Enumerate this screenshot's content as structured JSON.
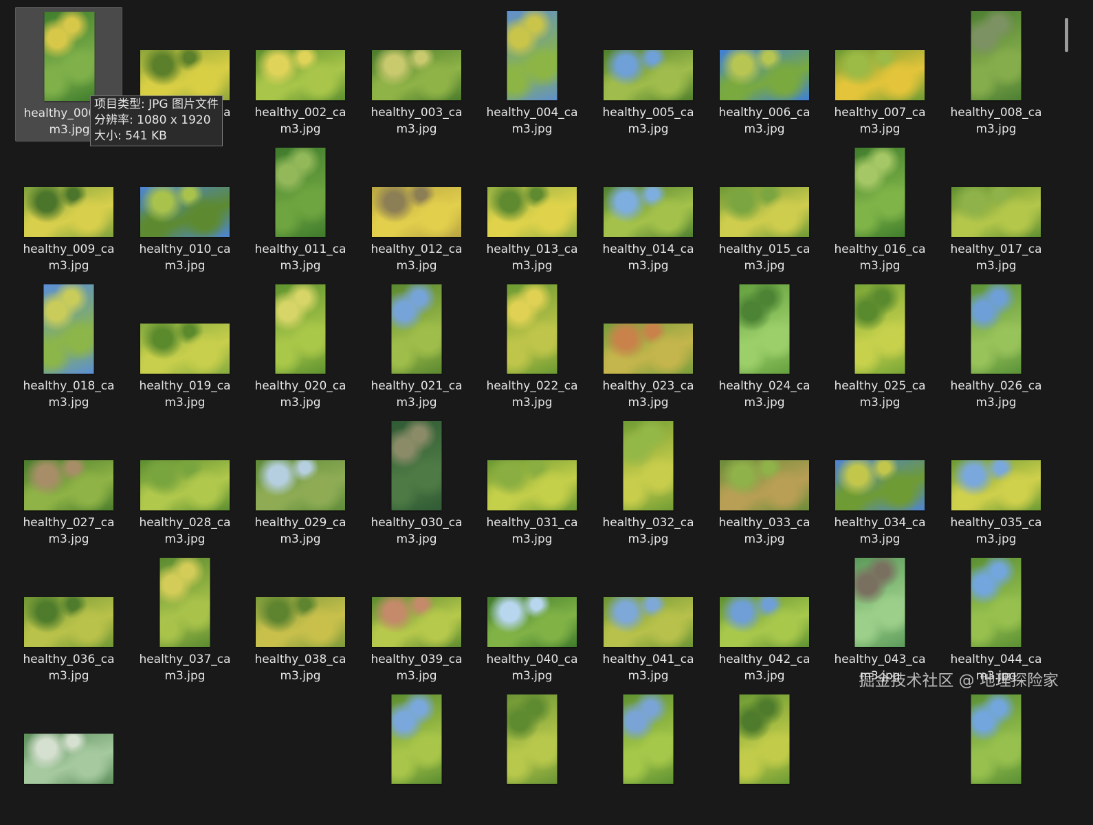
{
  "files": [
    {
      "line1": "healthy_000_ca",
      "line2": "m3.jpg",
      "orientation": "portrait",
      "colors": [
        "#3f7d2d",
        "#7fb04a",
        "#d8c84a"
      ]
    },
    {
      "line1": "healthy_001_ca",
      "line2": "m3.jpg",
      "orientation": "landscape",
      "colors": [
        "#8ea63a",
        "#d9cf45",
        "#5b7f2a"
      ]
    },
    {
      "line1": "healthy_002_ca",
      "line2": "m3.jpg",
      "orientation": "landscape",
      "colors": [
        "#5d8f2f",
        "#a9c64a",
        "#e0d35a"
      ]
    },
    {
      "line1": "healthy_003_ca",
      "line2": "m3.jpg",
      "orientation": "landscape",
      "colors": [
        "#4a7a2c",
        "#8fb347",
        "#c9c96e"
      ]
    },
    {
      "line1": "healthy_004_ca",
      "line2": "m3.jpg",
      "orientation": "portrait",
      "colors": [
        "#5f8fcf",
        "#8cb546",
        "#c9c44a"
      ]
    },
    {
      "line1": "healthy_005_ca",
      "line2": "m3.jpg",
      "orientation": "landscape",
      "colors": [
        "#4f7f2c",
        "#9fbc4c",
        "#6fa0d8"
      ]
    },
    {
      "line1": "healthy_006_ca",
      "line2": "m3.jpg",
      "orientation": "landscape",
      "colors": [
        "#3f7fd8",
        "#79a93f",
        "#b7c552"
      ]
    },
    {
      "line1": "healthy_007_ca",
      "line2": "m3.jpg",
      "orientation": "landscape",
      "colors": [
        "#6b9a34",
        "#e3c43a",
        "#9bba46"
      ]
    },
    {
      "line1": "healthy_008_ca",
      "line2": "m3.jpg",
      "orientation": "portrait",
      "colors": [
        "#4c7e32",
        "#86ad4c",
        "#7d9263"
      ]
    },
    {
      "line1": "healthy_009_ca",
      "line2": "m3.jpg",
      "orientation": "landscape",
      "colors": [
        "#7da23d",
        "#d8cf4c",
        "#4b752a"
      ]
    },
    {
      "line1": "healthy_010_ca",
      "line2": "m3.jpg",
      "orientation": "landscape",
      "colors": [
        "#4d86d6",
        "#5d8a30",
        "#a8c24c"
      ]
    },
    {
      "line1": "healthy_011_ca",
      "line2": "m3.jpg",
      "orientation": "portrait",
      "colors": [
        "#3e7a2c",
        "#6ea540",
        "#93b85a"
      ]
    },
    {
      "line1": "healthy_012_ca",
      "line2": "m3.jpg",
      "orientation": "landscape",
      "colors": [
        "#b8a543",
        "#e2cf4c",
        "#8d7f55"
      ]
    },
    {
      "line1": "healthy_013_ca",
      "line2": "m3.jpg",
      "orientation": "landscape",
      "colors": [
        "#94b042",
        "#e0d34b",
        "#5f8a30"
      ]
    },
    {
      "line1": "healthy_014_ca",
      "line2": "m3.jpg",
      "orientation": "landscape",
      "colors": [
        "#4f8030",
        "#a4c24b",
        "#7eaee0"
      ]
    },
    {
      "line1": "healthy_015_ca",
      "line2": "m3.jpg",
      "orientation": "landscape",
      "colors": [
        "#6d9836",
        "#cfcd4e",
        "#7aa540"
      ]
    },
    {
      "line1": "healthy_016_ca",
      "line2": "m3.jpg",
      "orientation": "portrait",
      "colors": [
        "#3f7c2c",
        "#7fb448",
        "#a6c765"
      ]
    },
    {
      "line1": "healthy_017_ca",
      "line2": "m3.jpg",
      "orientation": "landscape",
      "colors": [
        "#5f8f31",
        "#b4c74b",
        "#8fb24a"
      ]
    },
    {
      "line1": "healthy_018_ca",
      "line2": "m3.jpg",
      "orientation": "portrait",
      "colors": [
        "#5a8ed8",
        "#8cb54a",
        "#c9cc5a"
      ]
    },
    {
      "line1": "healthy_019_ca",
      "line2": "m3.jpg",
      "orientation": "landscape",
      "colors": [
        "#84aa3f",
        "#c8cf4c",
        "#5b8a2d"
      ]
    },
    {
      "line1": "healthy_020_ca",
      "line2": "m3.jpg",
      "orientation": "portrait",
      "colors": [
        "#5e922f",
        "#a9c749",
        "#d7d567"
      ]
    },
    {
      "line1": "healthy_021_ca",
      "line2": "m3.jpg",
      "orientation": "portrait",
      "colors": [
        "#5a8730",
        "#9fbd4a",
        "#77a4d8"
      ]
    },
    {
      "line1": "healthy_022_ca",
      "line2": "m3.jpg",
      "orientation": "portrait",
      "colors": [
        "#6b9a32",
        "#bfc54a",
        "#e0d154"
      ]
    },
    {
      "line1": "healthy_023_ca",
      "line2": "m3.jpg",
      "orientation": "landscape",
      "colors": [
        "#779d3b",
        "#c4b54c",
        "#c9824a"
      ]
    },
    {
      "line1": "healthy_024_ca",
      "line2": "m3.jpg",
      "orientation": "portrait",
      "colors": [
        "#64a03e",
        "#9ccf6a",
        "#4c8334"
      ]
    },
    {
      "line1": "healthy_025_ca",
      "line2": "m3.jpg",
      "orientation": "portrait",
      "colors": [
        "#77a536",
        "#c7d14c",
        "#5a8a2e"
      ]
    },
    {
      "line1": "healthy_026_ca",
      "line2": "m3.jpg",
      "orientation": "portrait",
      "colors": [
        "#5a9238",
        "#98c25a",
        "#6e9fd6"
      ]
    },
    {
      "line1": "healthy_027_ca",
      "line2": "m3.jpg",
      "orientation": "landscape",
      "colors": [
        "#4a7c2d",
        "#8fb346",
        "#a88e68"
      ]
    },
    {
      "line1": "healthy_028_ca",
      "line2": "m3.jpg",
      "orientation": "landscape",
      "colors": [
        "#5b8d30",
        "#b0c84c",
        "#79a53f"
      ]
    },
    {
      "line1": "healthy_029_ca",
      "line2": "m3.jpg",
      "orientation": "landscape",
      "colors": [
        "#5e8b38",
        "#8fac55",
        "#b6cfe0"
      ]
    },
    {
      "line1": "healthy_030_ca",
      "line2": "m3.jpg",
      "orientation": "portrait",
      "colors": [
        "#2f5a34",
        "#4e7a45",
        "#8b8b68"
      ]
    },
    {
      "line1": "healthy_031_ca",
      "line2": "m3.jpg",
      "orientation": "landscape",
      "colors": [
        "#6a9833",
        "#c4cf4a",
        "#8aae42"
      ]
    },
    {
      "line1": "healthy_032_ca",
      "line2": "m3.jpg",
      "orientation": "portrait",
      "colors": [
        "#6f9c34",
        "#c8cd4c",
        "#94b848"
      ]
    },
    {
      "line1": "healthy_033_ca",
      "line2": "m3.jpg",
      "orientation": "landscape",
      "colors": [
        "#6b8c3a",
        "#b89f55",
        "#8fb24a"
      ]
    },
    {
      "line1": "healthy_034_ca",
      "line2": "m3.jpg",
      "orientation": "landscape",
      "colors": [
        "#4f84d4",
        "#6f9b34",
        "#c2c74c"
      ]
    },
    {
      "line1": "healthy_035_ca",
      "line2": "m3.jpg",
      "orientation": "landscape",
      "colors": [
        "#6a9a34",
        "#cfd04c",
        "#7aa8dc"
      ]
    },
    {
      "line1": "healthy_036_ca",
      "line2": "m3.jpg",
      "orientation": "landscape",
      "colors": [
        "#6e9634",
        "#b9c24a",
        "#4f7c2c"
      ]
    },
    {
      "line1": "healthy_037_ca",
      "line2": "m3.jpg",
      "orientation": "portrait",
      "colors": [
        "#5a8a30",
        "#a8c24a",
        "#d3cc58"
      ]
    },
    {
      "line1": "healthy_038_ca",
      "line2": "m3.jpg",
      "orientation": "landscape",
      "colors": [
        "#7b9a3a",
        "#c9c04c",
        "#5e8430"
      ]
    },
    {
      "line1": "healthy_039_ca",
      "line2": "m3.jpg",
      "orientation": "landscape",
      "colors": [
        "#5c8a30",
        "#b7c94c",
        "#c48a6a"
      ]
    },
    {
      "line1": "healthy_040_ca",
      "line2": "m3.jpg",
      "orientation": "landscape",
      "colors": [
        "#3f7a2c",
        "#80b246",
        "#b8d6ee"
      ]
    },
    {
      "line1": "healthy_041_ca",
      "line2": "m3.jpg",
      "orientation": "landscape",
      "colors": [
        "#6a9434",
        "#b7c14b",
        "#7da8d8"
      ]
    },
    {
      "line1": "healthy_042_ca",
      "line2": "m3.jpg",
      "orientation": "landscape",
      "colors": [
        "#5f9132",
        "#a8c84c",
        "#6f9fd6"
      ]
    },
    {
      "line1": "healthy_043_ca",
      "line2": "m3.jpg",
      "orientation": "portrait",
      "colors": [
        "#5c9a5a",
        "#9ccf8a",
        "#7a7060"
      ]
    },
    {
      "line1": "healthy_044_ca",
      "line2": "m3.jpg",
      "orientation": "portrait",
      "colors": [
        "#5a8f34",
        "#97c04e",
        "#72a6dc"
      ]
    },
    {
      "line1": "",
      "line2": "",
      "orientation": "landscape",
      "colors": [
        "#5c8f5a",
        "#a6c9a0",
        "#d6e0d0"
      ]
    },
    {
      "line1": "",
      "line2": "",
      "orientation": "hidden",
      "colors": []
    },
    {
      "line1": "",
      "line2": "",
      "orientation": "hidden",
      "colors": []
    },
    {
      "line1": "",
      "line2": "",
      "orientation": "portrait",
      "colors": [
        "#5b8c30",
        "#a9c64a",
        "#7aa8dc"
      ]
    },
    {
      "line1": "",
      "line2": "",
      "orientation": "portrait",
      "colors": [
        "#6a9434",
        "#b8c84c",
        "#5e8a30"
      ]
    },
    {
      "line1": "",
      "line2": "",
      "orientation": "portrait",
      "colors": [
        "#5e9132",
        "#a6c84a",
        "#7aa4d6"
      ]
    },
    {
      "line1": "",
      "line2": "",
      "orientation": "portrait",
      "colors": [
        "#6b9a34",
        "#c2cc4a",
        "#4f7c2c"
      ]
    },
    {
      "line1": "",
      "line2": "",
      "orientation": "hidden",
      "colors": []
    },
    {
      "line1": "",
      "line2": "",
      "orientation": "portrait",
      "colors": [
        "#5a8f34",
        "#97c04e",
        "#72a6dc"
      ]
    }
  ],
  "selected_index": 0,
  "tooltip": {
    "type_line": "项目类型: JPG 图片文件",
    "resolution_line": "分辨率: 1080 x 1920",
    "size_line": "大小: 541 KB"
  },
  "watermark": "掘金技术社区 @ 地理探险家"
}
